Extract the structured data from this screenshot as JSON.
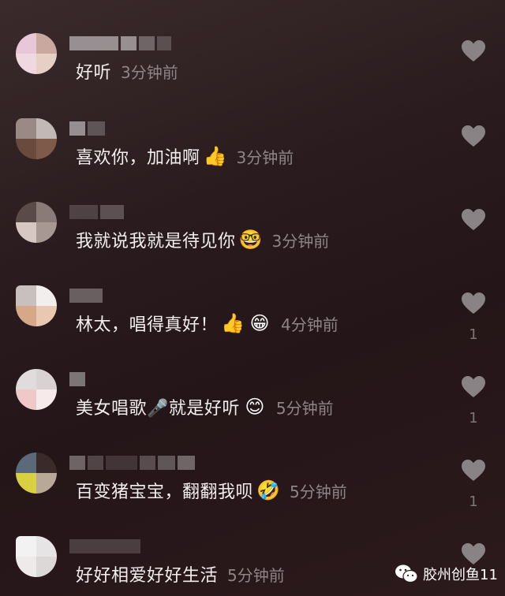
{
  "comments": [
    {
      "text": "好听",
      "time": "3分钟前",
      "emojis": [],
      "likes": ""
    },
    {
      "text": "喜欢你，加油啊",
      "time": "3分钟前",
      "emojis": [
        "👍"
      ],
      "likes": ""
    },
    {
      "text": "我就说我就是待见你",
      "time": "3分钟前",
      "emojis": [
        "🤓"
      ],
      "likes": ""
    },
    {
      "text": "林太，唱得真好！",
      "time": "4分钟前",
      "emojis": [
        "👍",
        "😁"
      ],
      "likes": "1"
    },
    {
      "text": "美女唱歌🎤就是好听",
      "time": "5分钟前",
      "emojis": [
        "😊"
      ],
      "likes": "1"
    },
    {
      "text": "百变猪宝宝，翻翻我呗",
      "time": "5分钟前",
      "emojis": [
        "🤣"
      ],
      "likes": "1"
    },
    {
      "text": "好好相爱好好生活",
      "time": "5分钟前",
      "emojis": [],
      "likes": ""
    }
  ],
  "watermark": {
    "text": "胶州创鱼11",
    "icon": "wechat-icon"
  },
  "colors": {
    "like_heart": "#8a8385",
    "text": "#f2eeee",
    "time": "#8d8587"
  }
}
